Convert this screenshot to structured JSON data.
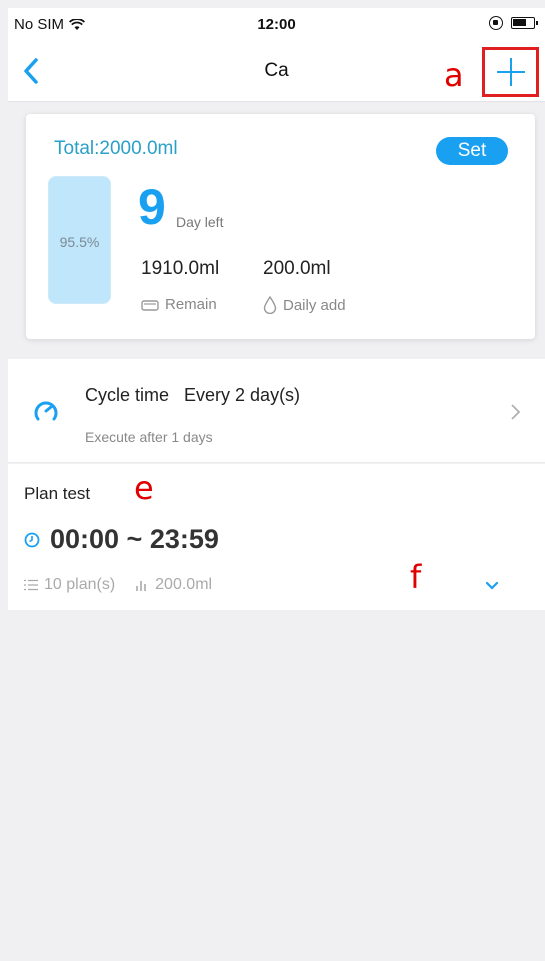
{
  "status_bar": {
    "carrier": "No SIM",
    "time": "12:00"
  },
  "nav": {
    "title": "Ca"
  },
  "annotations": {
    "a": "a",
    "e": "e",
    "f": "f"
  },
  "card": {
    "total": "Total:2000.0ml",
    "set_label": "Set",
    "tank_percent_text": "95.5%",
    "tank_fill_percent": 95.5,
    "days_left_value": "9",
    "days_left_label": "Day left",
    "remain_value": "1910.0ml",
    "remain_label": "Remain",
    "daily_add_value": "200.0ml",
    "daily_add_label": "Daily add"
  },
  "cycle": {
    "title": "Cycle time   Every 2 day(s)",
    "subtitle": "Execute after 1 days"
  },
  "plan": {
    "title": "Plan test",
    "time_range": "00:00 ~ 23:59",
    "plan_count": "10 plan(s)",
    "volume": "200.0ml"
  },
  "colors": {
    "accent": "#1aa0f0",
    "total_text": "#2aa0c8",
    "tank": "#bfe6fb",
    "annotation": "#e00000"
  }
}
